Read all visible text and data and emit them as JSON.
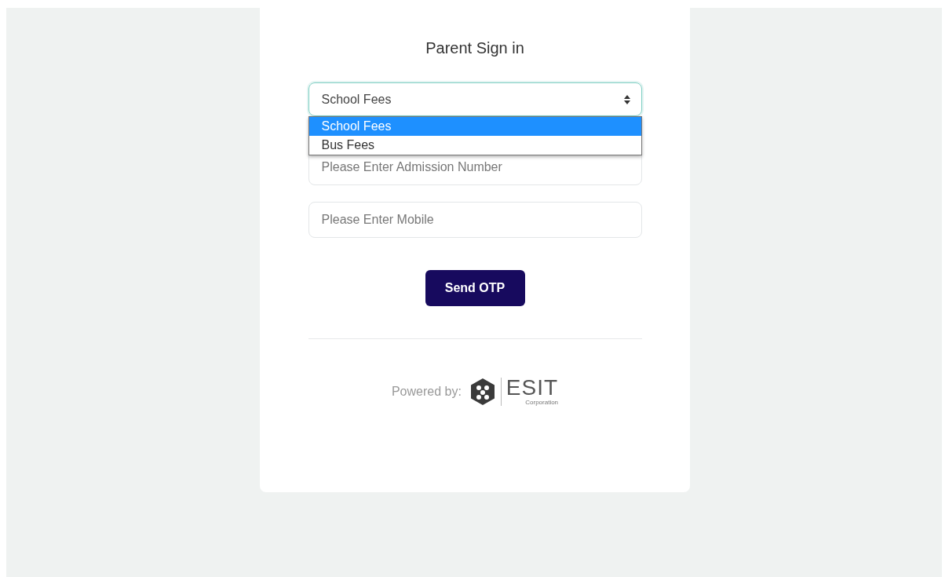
{
  "title": "Parent Sign in",
  "fee_select": {
    "value": "School Fees",
    "expanded": true,
    "options": [
      {
        "label": "School Fees",
        "selected": true
      },
      {
        "label": "Bus Fees",
        "selected": false
      }
    ]
  },
  "fields": [
    {
      "placeholder": "Please Enter Admission Number"
    },
    {
      "placeholder": "Please Enter Mobile"
    }
  ],
  "submit_button": "Send OTP",
  "footer": {
    "label": "Powered by:",
    "logo_text": "ESIT",
    "logo_subtext": "Corporation"
  }
}
